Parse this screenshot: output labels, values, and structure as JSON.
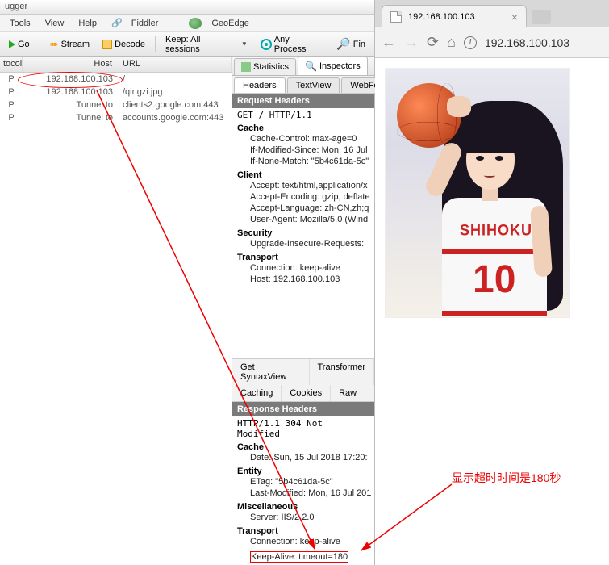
{
  "titlebar": "ugger",
  "menu": {
    "tools": "Tools",
    "view": "View",
    "help": "Help",
    "fiddler": "Fiddler",
    "geoedge": "GeoEdge"
  },
  "toolbar": {
    "go": "Go",
    "stream": "Stream",
    "decode": "Decode",
    "keep": "Keep: All sessions",
    "anyproc": "Any Process",
    "find": "Fin"
  },
  "sessions": {
    "cols": {
      "proto": "tocol",
      "host": "Host",
      "url": "URL"
    },
    "rows": [
      {
        "proto": "P",
        "host": "192.168.100.103",
        "url": "/",
        "highlighted": true
      },
      {
        "proto": "P",
        "host": "192.168.100.103",
        "url": "/qingzi.jpg"
      },
      {
        "proto": "P",
        "host": "Tunnel to",
        "url": "clients2.google.com:443"
      },
      {
        "proto": "P",
        "host": "Tunnel to",
        "url": "accounts.google.com:443"
      }
    ]
  },
  "inspector_tabs": {
    "stats": "Statistics",
    "insp": "Inspectors"
  },
  "subtabs_top": {
    "headers": "Headers",
    "textview": "TextView",
    "webfor": "WebFor"
  },
  "request": {
    "title": "Request Headers",
    "line": "GET / HTTP/1.1",
    "groups": [
      {
        "name": "Cache",
        "items": [
          "Cache-Control: max-age=0",
          "If-Modified-Since: Mon, 16 Jul",
          "If-None-Match: \"5b4c61da-5c\""
        ]
      },
      {
        "name": "Client",
        "items": [
          "Accept: text/html,application/x",
          "Accept-Encoding: gzip, deflate",
          "Accept-Language: zh-CN,zh;q",
          "User-Agent: Mozilla/5.0 (Wind"
        ]
      },
      {
        "name": "Security",
        "items": [
          "Upgrade-Insecure-Requests:"
        ]
      },
      {
        "name": "Transport",
        "items": [
          "Connection: keep-alive",
          "Host: 192.168.100.103"
        ]
      }
    ]
  },
  "midbar": {
    "row1": [
      "Get SyntaxView",
      "Transformer"
    ],
    "row2": [
      "Caching",
      "Cookies",
      "Raw"
    ]
  },
  "response": {
    "title": "Response Headers",
    "line": "HTTP/1.1 304 Not Modified",
    "groups": [
      {
        "name": "Cache",
        "items": [
          "Date: Sun, 15 Jul 2018 17:20:"
        ]
      },
      {
        "name": "Entity",
        "items": [
          "ETag: \"5b4c61da-5c\"",
          "Last-Modified: Mon, 16 Jul 201"
        ]
      },
      {
        "name": "Miscellaneous",
        "items": [
          "Server: IIS/2.2.0"
        ]
      },
      {
        "name": "Transport",
        "items": [
          "Connection: keep-alive"
        ]
      }
    ],
    "keepalive": "Keep-Alive: timeout=180"
  },
  "browser": {
    "tab_title": "192.168.100.103",
    "address": "192.168.100.103"
  },
  "jersey": {
    "text": "SHIHOKU",
    "num": "10"
  },
  "annotation": "显示超时时间是180秒"
}
